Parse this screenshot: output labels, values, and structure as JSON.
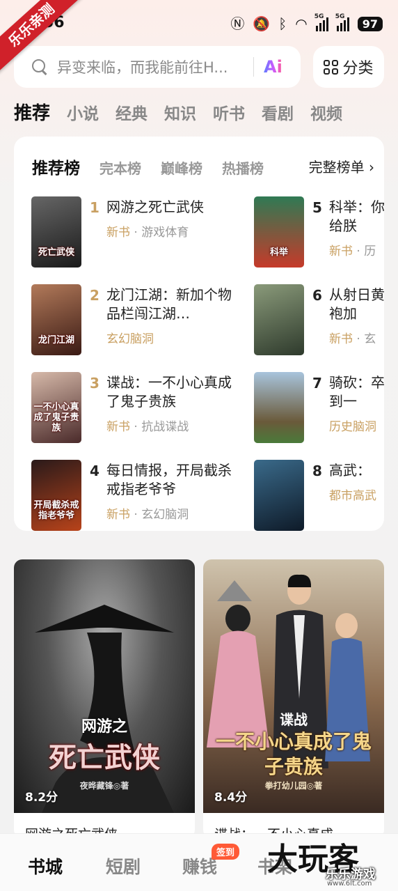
{
  "watermark": {
    "ribbon": "乐乐亲测",
    "logo": "大玩客",
    "logo_sub": "乐乐游戏",
    "url": "www.6lt.com"
  },
  "status_bar": {
    "time": "56",
    "battery": "97",
    "signal_tag": "5G"
  },
  "search": {
    "placeholder": "异变来临，而我能前往H...",
    "ai_label": "Ai"
  },
  "category_button": {
    "label": "分类"
  },
  "tabs": [
    "推荐",
    "小说",
    "经典",
    "知识",
    "听书",
    "看剧",
    "视频"
  ],
  "ranking": {
    "tabs": [
      "推荐榜",
      "完本榜",
      "巅峰榜",
      "热播榜"
    ],
    "full_list_label": "完整榜单 ›",
    "books": [
      {
        "rank": "1",
        "title": "网游之死亡武侠",
        "tag": "新书",
        "meta": " · 游戏体育",
        "cover_text": "死亡武侠",
        "cover_color": "#2a2a2a"
      },
      {
        "rank": "2",
        "title": "龙门江湖：新加个物品栏闯江湖…",
        "tag": "",
        "meta": "玄幻脑洞",
        "cover_text": "龙门江湖",
        "cover_color": "#5a3428"
      },
      {
        "rank": "3",
        "title": "谍战：一不小心真成了鬼子贵族",
        "tag": "新书",
        "meta": " · 抗战谍战",
        "cover_text": "一不小心真成了鬼子贵族",
        "cover_color": "#6b4a4a"
      },
      {
        "rank": "4",
        "title": "每日情报，开局截杀戒指老爷爷",
        "tag": "新书",
        "meta": " · 玄幻脑洞",
        "cover_text": "开局截杀戒指老爷爷",
        "cover_color": "#8a2a1a"
      },
      {
        "rank": "5",
        "title": "科举：你给朕",
        "tag": "新书",
        "meta": " · 历",
        "cover_text": "科举",
        "cover_color": "#2f7a54"
      },
      {
        "rank": "6",
        "title": "从射日黄袍加",
        "tag": "新书",
        "meta": " · 玄",
        "cover_text": "",
        "cover_color": "#3e4a3c"
      },
      {
        "rank": "7",
        "title": "骑砍：卒到一",
        "tag": "",
        "meta": "历史脑洞",
        "cover_text": "",
        "cover_color": "#7a9ab8"
      },
      {
        "rank": "8",
        "title": "高武：",
        "tag": "",
        "meta": "都市高武",
        "cover_text": "",
        "cover_color": "#1e3850"
      }
    ]
  },
  "featured": [
    {
      "title": "网游之死亡武侠",
      "score": "8.2分",
      "cover_big": "死亡武侠",
      "cover_small": "网游之",
      "author": "夜晔藏锋◎著"
    },
    {
      "title": "谍战：一不小心真成",
      "score": "8.4分",
      "cover_big": "一不小心真成了鬼子贵族",
      "cover_small": "谍战",
      "author": "拳打幼儿园◎著"
    }
  ],
  "bottom_nav": {
    "items": [
      "书城",
      "短剧",
      "赚钱",
      "书架"
    ],
    "badge": "签到"
  },
  "colors": {
    "accent_gold": "#c9a062",
    "badge": "#ff5a36",
    "ribbon": "#d0212a"
  }
}
